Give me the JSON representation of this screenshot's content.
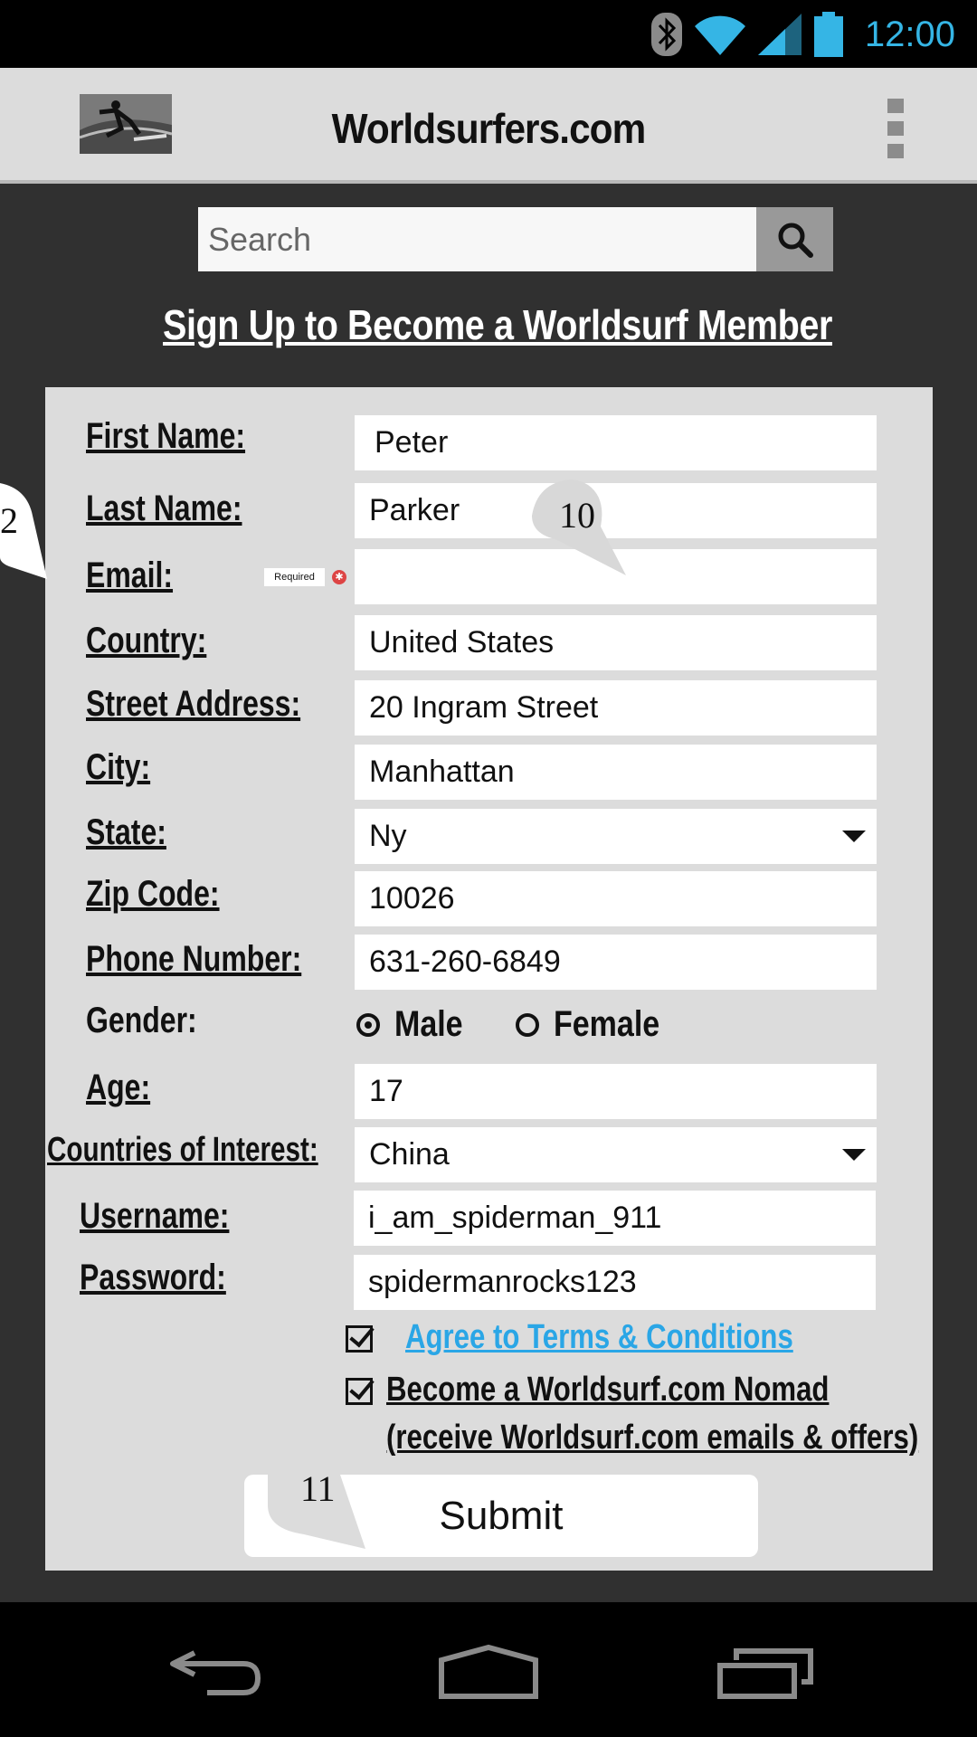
{
  "status_bar": {
    "time": "12:00"
  },
  "app_bar": {
    "title": "Worldsurfers.com",
    "logo_icon": "surfer-logo"
  },
  "search": {
    "placeholder": "Search"
  },
  "page": {
    "heading": "Sign Up to Become a Worldsurf Member"
  },
  "form": {
    "required_tag": "Required",
    "fields": {
      "first_name": {
        "label": "First Name:",
        "value": "Peter"
      },
      "last_name": {
        "label": "Last Name:",
        "value": "Parker"
      },
      "email": {
        "label": "Email:",
        "value": ""
      },
      "country": {
        "label": "Country:",
        "value": "United States"
      },
      "street": {
        "label": "Street Address:",
        "value": "20 Ingram Street"
      },
      "city": {
        "label": "City:",
        "value": "Manhattan"
      },
      "state": {
        "label": "State:",
        "value": "Ny"
      },
      "zip": {
        "label": "Zip Code:",
        "value": "10026"
      },
      "phone": {
        "label": "Phone Number:",
        "value": "631-260-6849"
      },
      "gender": {
        "label": "Gender:",
        "options": [
          "Male",
          "Female"
        ],
        "selected": "Male"
      },
      "age": {
        "label": "Age:",
        "value": "17"
      },
      "countries_of_interest": {
        "label": "Countries of Interest:",
        "value": "China"
      },
      "username": {
        "label": "Username:",
        "value": "i_am_spiderman_911"
      },
      "password": {
        "label": "Password:",
        "value": "spidermanrocks123"
      }
    },
    "terms_label": "Agree to Terms & Conditions",
    "nomad_label_line1": "Become a Worldsurf.com Nomad ",
    "nomad_label_line2": "(receive Worldsurf.com emails & offers)",
    "submit_label": "Submit"
  },
  "callouts": [
    "2",
    "10",
    "11"
  ],
  "colors": {
    "link": "#2aa6e6",
    "status_time": "#35b5e5",
    "background": "#303030",
    "panel": "#dcdcdc"
  }
}
